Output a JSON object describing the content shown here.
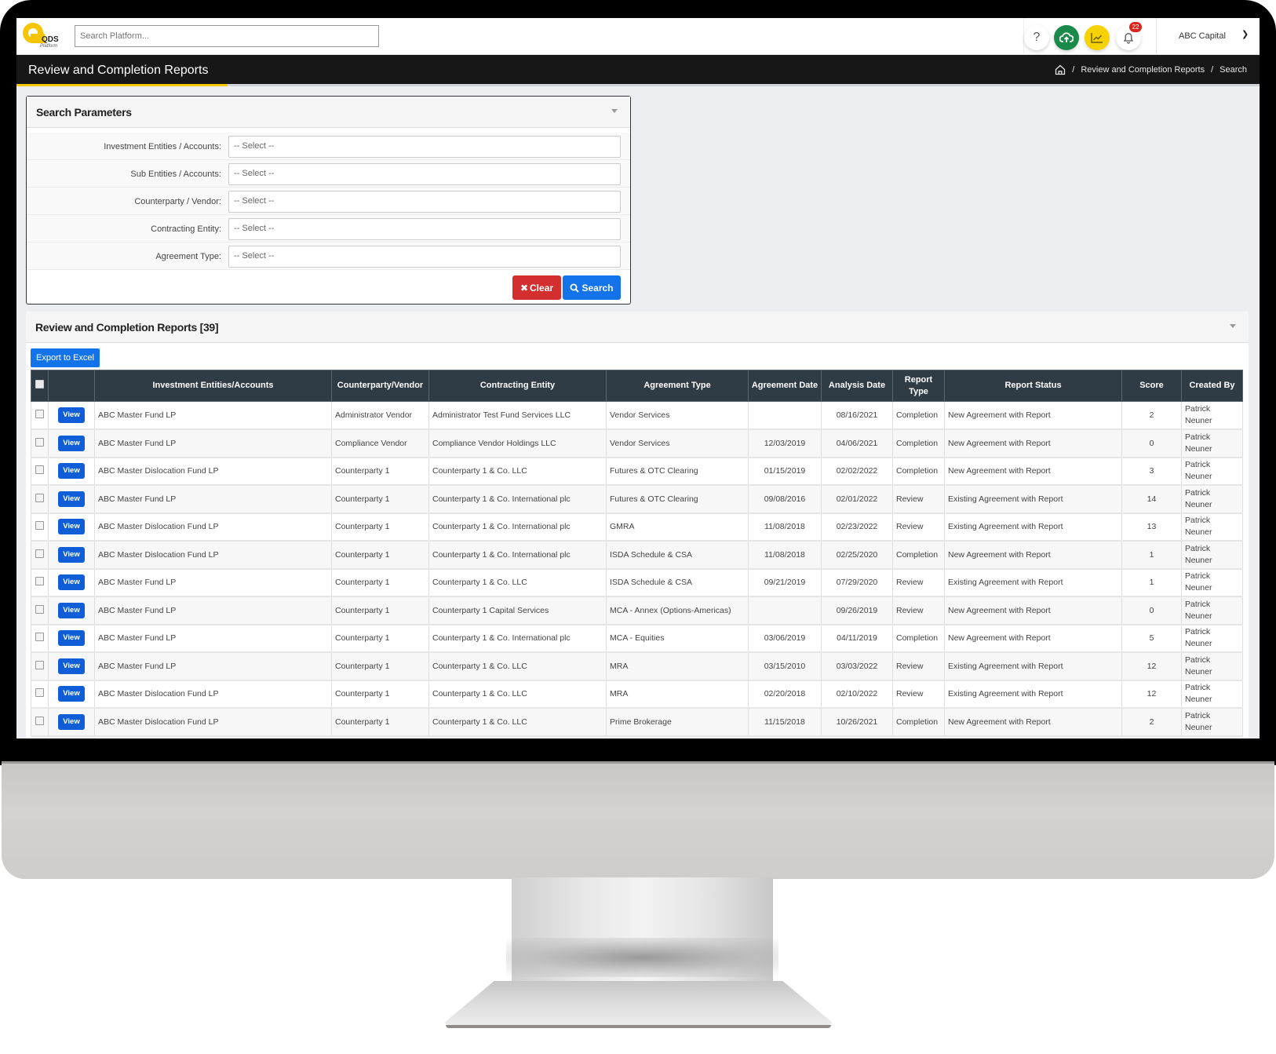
{
  "app": {
    "logo_text": "QDS",
    "logo_subtext": "Platform",
    "search_placeholder": "Search Platform...",
    "notification_count": "22",
    "account_name": "ABC Capital",
    "icons": [
      "help-icon",
      "cloud-upload-icon",
      "chart-line-icon",
      "bell-icon",
      "chevron-down-icon"
    ],
    "colors": {
      "brand_yellow": "#f6c700",
      "cloud_green": "#1a8a4a",
      "chart_yellow": "#f6d200",
      "primary_blue": "#1273eb",
      "danger_red": "#d32f2f",
      "header_dark": "#2f3b45"
    }
  },
  "page": {
    "title": "Review and Completion Reports",
    "breadcrumb": [
      "Review and Completion Reports",
      "Search"
    ]
  },
  "search_panel": {
    "title": "Search Parameters",
    "fields": [
      {
        "label": "Investment Entities / Accounts:",
        "value": "-- Select --"
      },
      {
        "label": "Sub Entities / Accounts:",
        "value": "-- Select --"
      },
      {
        "label": "Counterparty / Vendor:",
        "value": "-- Select --"
      },
      {
        "label": "Contracting Entity:",
        "value": "-- Select --"
      },
      {
        "label": "Agreement Type:",
        "value": "-- Select --"
      }
    ],
    "clear_label": "Clear",
    "search_label": "Search"
  },
  "reports": {
    "title": "Review and Completion Reports [39]",
    "export_label": "Export to Excel",
    "view_label": "View",
    "columns": [
      "Investment Entities/Accounts",
      "Counterparty/Vendor",
      "Contracting Entity",
      "Agreement Type",
      "Agreement Date",
      "Analysis Date",
      "Report Type",
      "Report Status",
      "Score",
      "Created By"
    ],
    "rows": [
      {
        "entity": "ABC Master Fund LP",
        "counterparty": "Administrator Vendor",
        "contracting": "Administrator Test Fund Services LLC",
        "agreement_type": "Vendor Services",
        "agreement_date": "",
        "analysis_date": "08/16/2021",
        "report_type": "Completion",
        "status": "New Agreement with Report",
        "score": "2",
        "created_by": "Patrick Neuner"
      },
      {
        "entity": "ABC Master Fund LP",
        "counterparty": "Compliance Vendor",
        "contracting": "Compliance Vendor Holdings LLC",
        "agreement_type": "Vendor Services",
        "agreement_date": "12/03/2019",
        "analysis_date": "04/06/2021",
        "report_type": "Completion",
        "status": "New Agreement with Report",
        "score": "0",
        "created_by": "Patrick Neuner"
      },
      {
        "entity": "ABC Master Dislocation Fund LP",
        "counterparty": "Counterparty 1",
        "contracting": "Counterparty 1 & Co. LLC",
        "agreement_type": "Futures & OTC Clearing",
        "agreement_date": "01/15/2019",
        "analysis_date": "02/02/2022",
        "report_type": "Completion",
        "status": "New Agreement with Report",
        "score": "3",
        "created_by": "Patrick Neuner"
      },
      {
        "entity": "ABC Master Fund LP",
        "counterparty": "Counterparty 1",
        "contracting": "Counterparty 1 & Co. International plc",
        "agreement_type": "Futures & OTC Clearing",
        "agreement_date": "09/08/2016",
        "analysis_date": "02/01/2022",
        "report_type": "Review",
        "status": "Existing Agreement with Report",
        "score": "14",
        "created_by": "Patrick Neuner"
      },
      {
        "entity": "ABC Master Dislocation Fund LP",
        "counterparty": "Counterparty 1",
        "contracting": "Counterparty 1 & Co. International plc",
        "agreement_type": "GMRA",
        "agreement_date": "11/08/2018",
        "analysis_date": "02/23/2022",
        "report_type": "Review",
        "status": "Existing Agreement with Report",
        "score": "13",
        "created_by": "Patrick Neuner"
      },
      {
        "entity": "ABC Master Dislocation Fund LP",
        "counterparty": "Counterparty 1",
        "contracting": "Counterparty 1 & Co. International plc",
        "agreement_type": "ISDA Schedule & CSA",
        "agreement_date": "11/08/2018",
        "analysis_date": "02/25/2020",
        "report_type": "Completion",
        "status": "New Agreement with Report",
        "score": "1",
        "created_by": "Patrick Neuner"
      },
      {
        "entity": "ABC Master Fund LP",
        "counterparty": "Counterparty 1",
        "contracting": "Counterparty 1 & Co. LLC",
        "agreement_type": "ISDA Schedule & CSA",
        "agreement_date": "09/21/2019",
        "analysis_date": "07/29/2020",
        "report_type": "Review",
        "status": "Existing Agreement with Report",
        "score": "1",
        "created_by": "Patrick Neuner"
      },
      {
        "entity": "ABC Master Fund LP",
        "counterparty": "Counterparty 1",
        "contracting": "Counterparty 1 Capital Services",
        "agreement_type": "MCA - Annex (Options-Americas)",
        "agreement_date": "",
        "analysis_date": "09/26/2019",
        "report_type": "Review",
        "status": "New Agreement with Report",
        "score": "0",
        "created_by": "Patrick Neuner"
      },
      {
        "entity": "ABC Master Fund LP",
        "counterparty": "Counterparty 1",
        "contracting": "Counterparty 1 & Co. International plc",
        "agreement_type": "MCA - Equities",
        "agreement_date": "03/06/2019",
        "analysis_date": "04/11/2019",
        "report_type": "Completion",
        "status": "New Agreement with Report",
        "score": "5",
        "created_by": "Patrick Neuner"
      },
      {
        "entity": "ABC Master Fund LP",
        "counterparty": "Counterparty 1",
        "contracting": "Counterparty 1 & Co. LLC",
        "agreement_type": "MRA",
        "agreement_date": "03/15/2010",
        "analysis_date": "03/03/2022",
        "report_type": "Review",
        "status": "Existing Agreement with Report",
        "score": "12",
        "created_by": "Patrick Neuner"
      },
      {
        "entity": "ABC Master Dislocation Fund LP",
        "counterparty": "Counterparty 1",
        "contracting": "Counterparty 1 & Co. LLC",
        "agreement_type": "MRA",
        "agreement_date": "02/20/2018",
        "analysis_date": "02/10/2022",
        "report_type": "Review",
        "status": "Existing Agreement with Report",
        "score": "12",
        "created_by": "Patrick Neuner"
      },
      {
        "entity": "ABC Master Dislocation Fund LP",
        "counterparty": "Counterparty 1",
        "contracting": "Counterparty 1 & Co. LLC",
        "agreement_type": "Prime Brokerage",
        "agreement_date": "11/15/2018",
        "analysis_date": "10/26/2021",
        "report_type": "Completion",
        "status": "New Agreement with Report",
        "score": "2",
        "created_by": "Patrick Neuner"
      }
    ]
  }
}
